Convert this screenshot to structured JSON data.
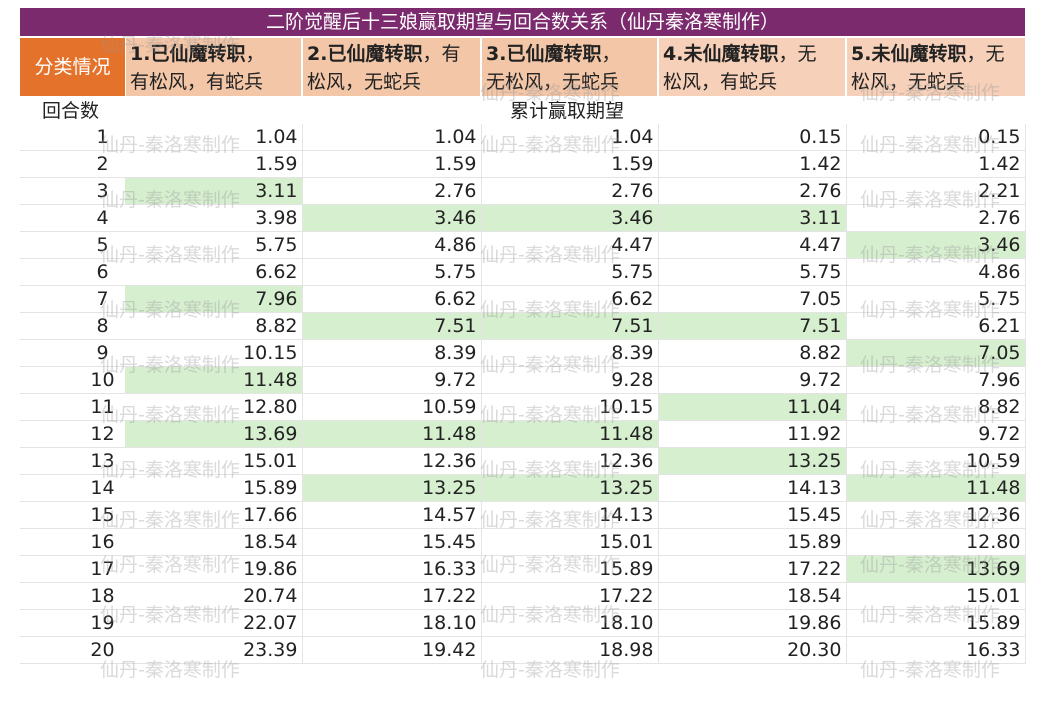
{
  "title": "二阶觉醒后十三娘赢取期望与回合数关系（仙丹秦洛寒制作）",
  "category_label": "分类情况",
  "columns": [
    {
      "head": "1.已仙魔转职",
      "tail": "，",
      "line2": "有松风，有蛇兵"
    },
    {
      "head": "2.已仙魔转职",
      "tail": "，有",
      "line2": "松风，无蛇兵"
    },
    {
      "head": "3.已仙魔转职",
      "tail": "，",
      "line2": "无松风，无蛇兵"
    },
    {
      "head": "4.未仙魔转职",
      "tail": "，无",
      "line2": "松风，有蛇兵"
    },
    {
      "head": "5.未仙魔转职",
      "tail": "，无",
      "line2": "松风，无蛇兵"
    }
  ],
  "round_label": "回合数",
  "value_label": "累计赢取期望",
  "watermark": "仙丹-秦洛寒制作",
  "highlight_color": "#d6efcf",
  "rows": [
    {
      "r": "1",
      "v": [
        "1.04",
        "1.04",
        "1.04",
        "0.15",
        "0.15"
      ],
      "h": [
        0,
        0,
        0,
        0,
        0
      ]
    },
    {
      "r": "2",
      "v": [
        "1.59",
        "1.59",
        "1.59",
        "1.42",
        "1.42"
      ],
      "h": [
        0,
        0,
        0,
        0,
        0
      ]
    },
    {
      "r": "3",
      "v": [
        "3.11",
        "2.76",
        "2.76",
        "2.76",
        "2.21"
      ],
      "h": [
        1,
        0,
        0,
        0,
        0
      ]
    },
    {
      "r": "4",
      "v": [
        "3.98",
        "3.46",
        "3.46",
        "3.11",
        "2.76"
      ],
      "h": [
        0,
        1,
        1,
        1,
        0
      ]
    },
    {
      "r": "5",
      "v": [
        "5.75",
        "4.86",
        "4.47",
        "4.47",
        "3.46"
      ],
      "h": [
        0,
        0,
        0,
        0,
        1
      ]
    },
    {
      "r": "6",
      "v": [
        "6.62",
        "5.75",
        "5.75",
        "5.75",
        "4.86"
      ],
      "h": [
        0,
        0,
        0,
        0,
        0
      ]
    },
    {
      "r": "7",
      "v": [
        "7.96",
        "6.62",
        "6.62",
        "7.05",
        "5.75"
      ],
      "h": [
        1,
        0,
        0,
        0,
        0
      ]
    },
    {
      "r": "8",
      "v": [
        "8.82",
        "7.51",
        "7.51",
        "7.51",
        "6.21"
      ],
      "h": [
        0,
        1,
        1,
        1,
        0
      ]
    },
    {
      "r": "9",
      "v": [
        "10.15",
        "8.39",
        "8.39",
        "8.82",
        "7.05"
      ],
      "h": [
        0,
        0,
        0,
        0,
        1
      ]
    },
    {
      "r": "10",
      "v": [
        "11.48",
        "9.72",
        "9.28",
        "9.72",
        "7.96"
      ],
      "h": [
        1,
        0,
        0,
        0,
        0
      ]
    },
    {
      "r": "11",
      "v": [
        "12.80",
        "10.59",
        "10.15",
        "11.04",
        "8.82"
      ],
      "h": [
        0,
        0,
        0,
        1,
        0
      ]
    },
    {
      "r": "12",
      "v": [
        "13.69",
        "11.48",
        "11.48",
        "11.92",
        "9.72"
      ],
      "h": [
        1,
        1,
        1,
        0,
        0
      ]
    },
    {
      "r": "13",
      "v": [
        "15.01",
        "12.36",
        "12.36",
        "13.25",
        "10.59"
      ],
      "h": [
        0,
        0,
        0,
        1,
        0
      ]
    },
    {
      "r": "14",
      "v": [
        "15.89",
        "13.25",
        "13.25",
        "14.13",
        "11.48"
      ],
      "h": [
        0,
        1,
        1,
        0,
        1
      ]
    },
    {
      "r": "15",
      "v": [
        "17.66",
        "14.57",
        "14.13",
        "15.45",
        "12.36"
      ],
      "h": [
        0,
        0,
        0,
        0,
        0
      ]
    },
    {
      "r": "16",
      "v": [
        "18.54",
        "15.45",
        "15.01",
        "15.89",
        "12.80"
      ],
      "h": [
        0,
        0,
        0,
        0,
        0
      ]
    },
    {
      "r": "17",
      "v": [
        "19.86",
        "16.33",
        "15.89",
        "17.22",
        "13.69"
      ],
      "h": [
        0,
        0,
        0,
        0,
        1
      ]
    },
    {
      "r": "18",
      "v": [
        "20.74",
        "17.22",
        "17.22",
        "18.54",
        "15.01"
      ],
      "h": [
        0,
        0,
        0,
        0,
        0
      ]
    },
    {
      "r": "19",
      "v": [
        "22.07",
        "18.10",
        "18.10",
        "19.86",
        "15.89"
      ],
      "h": [
        0,
        0,
        0,
        0,
        0
      ]
    },
    {
      "r": "20",
      "v": [
        "23.39",
        "19.42",
        "18.98",
        "20.30",
        "16.33"
      ],
      "h": [
        0,
        0,
        0,
        0,
        0
      ]
    }
  ]
}
